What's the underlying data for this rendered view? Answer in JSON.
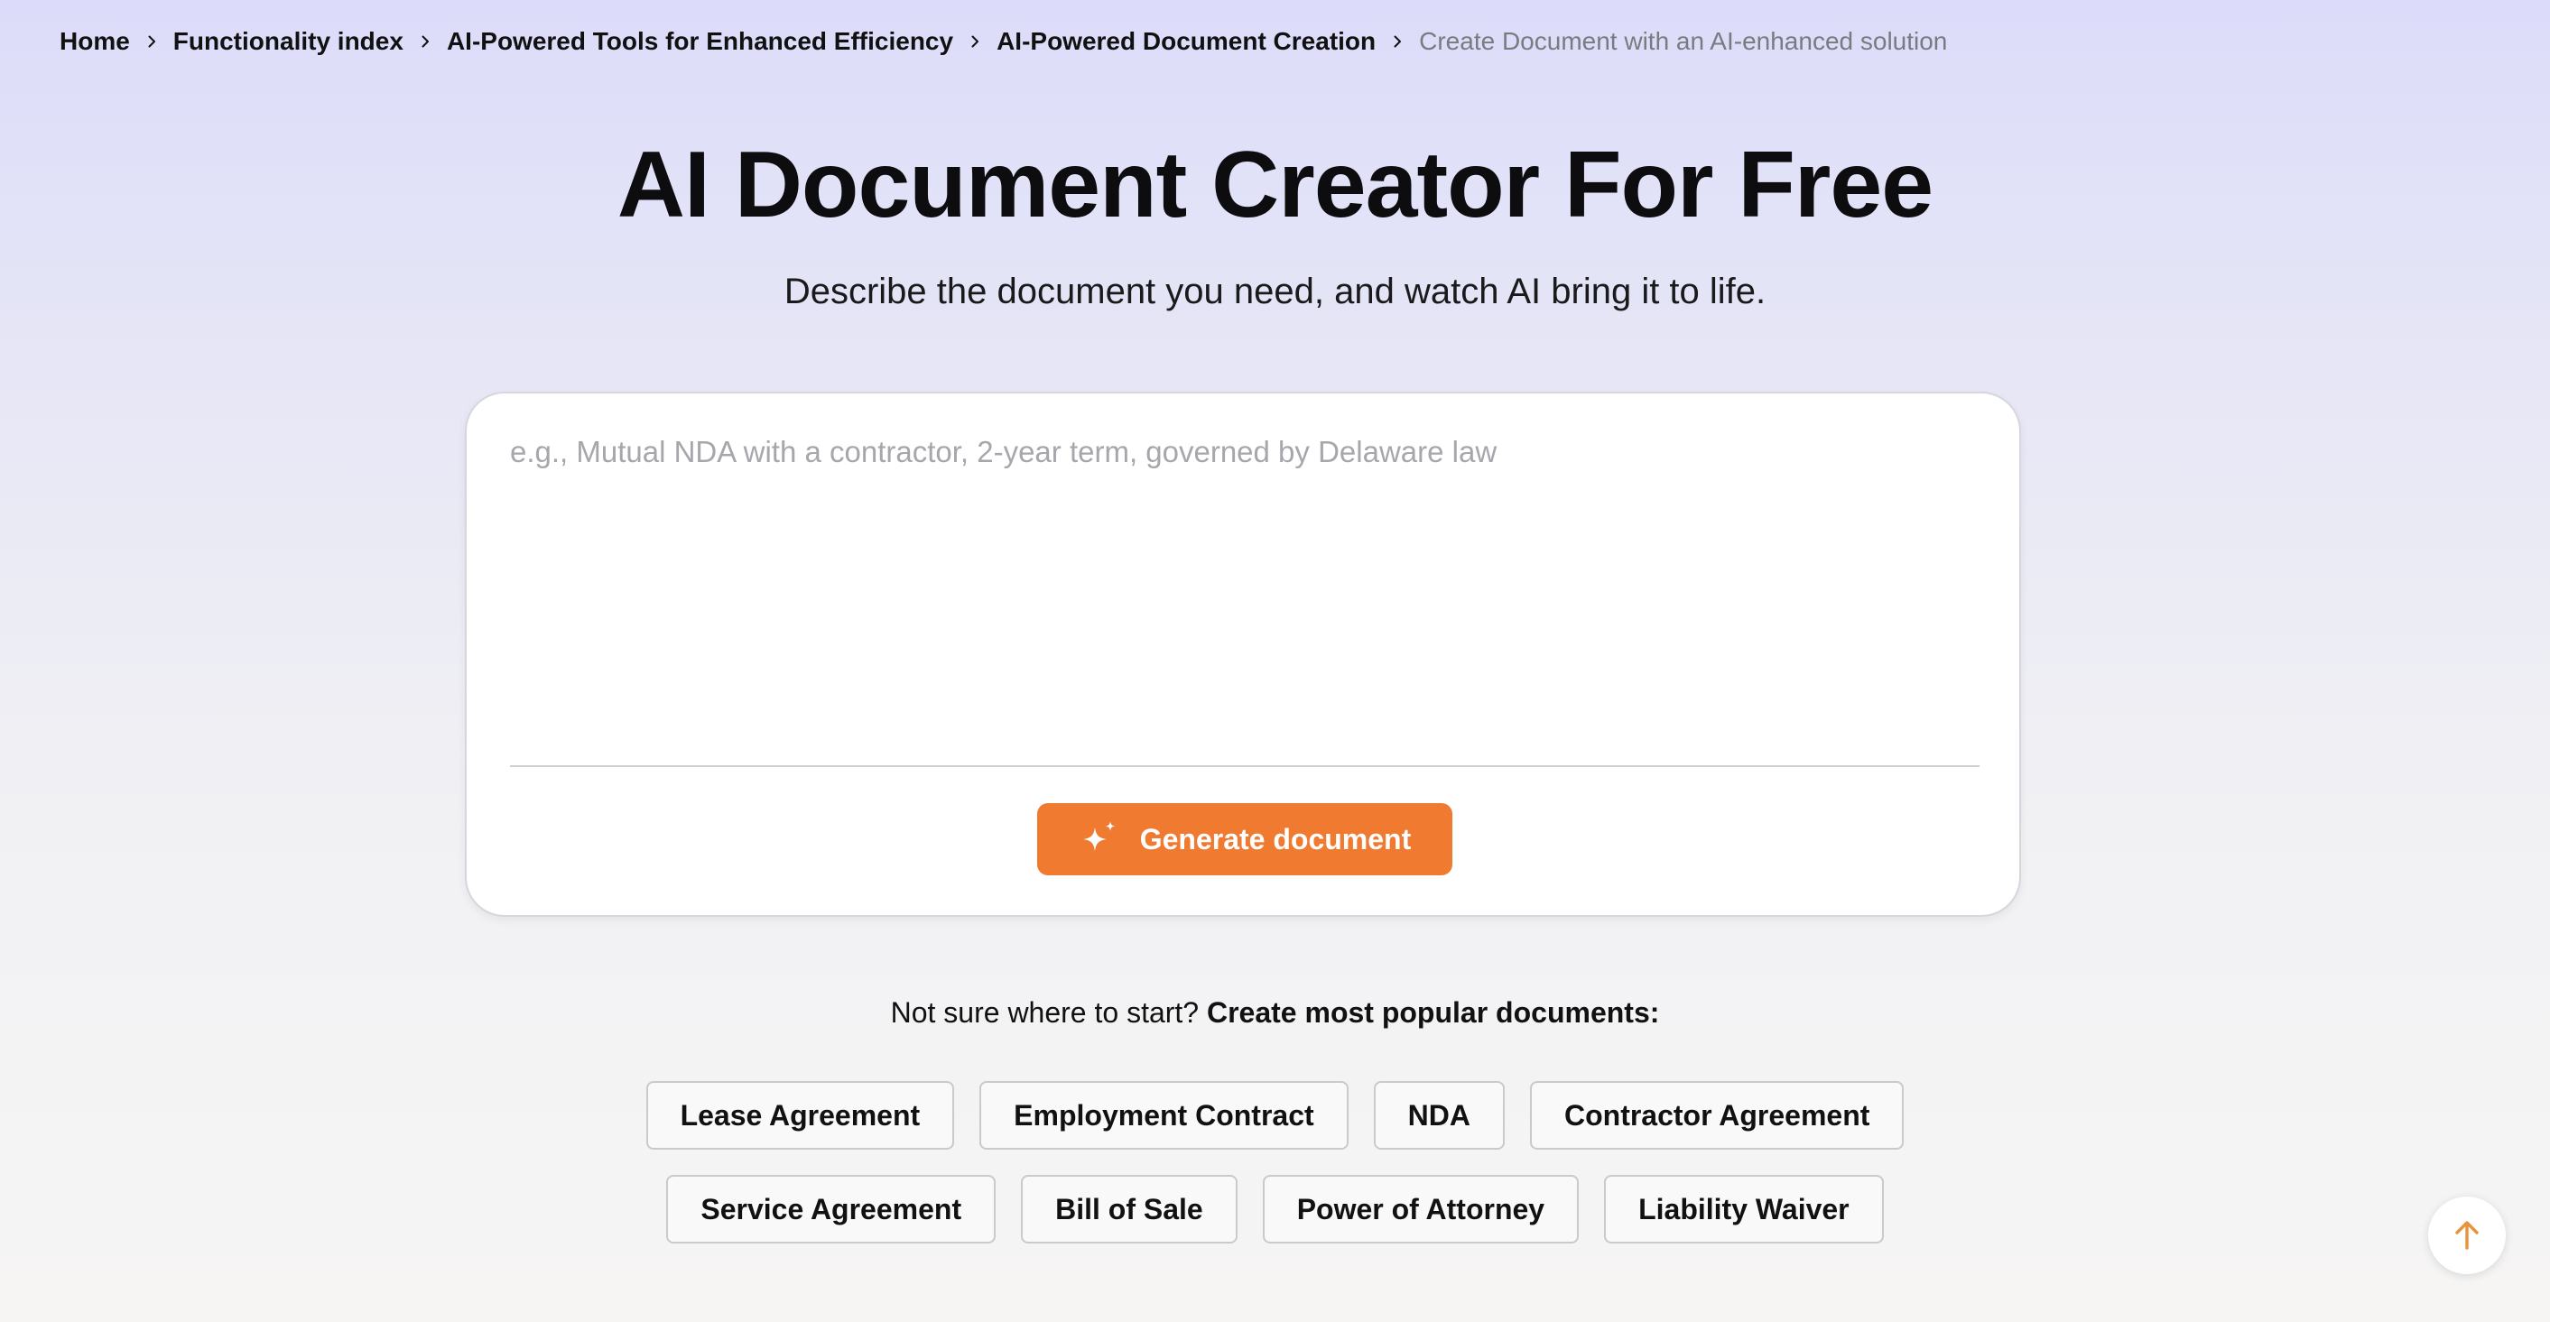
{
  "breadcrumb": {
    "items": [
      {
        "label": "Home"
      },
      {
        "label": "Functionality index"
      },
      {
        "label": "AI-Powered Tools for Enhanced Efficiency"
      },
      {
        "label": "AI-Powered Document Creation"
      },
      {
        "label": "Create Document with an AI-enhanced solution"
      }
    ],
    "separator_icon": "chevron-right-icon"
  },
  "hero": {
    "title": "AI Document Creator For Free",
    "subtitle": "Describe the document you need, and watch AI bring it to life."
  },
  "prompt": {
    "placeholder": "e.g., Mutual NDA with a contractor, 2-year term, governed by Delaware law",
    "value": "",
    "generate_label": "Generate document",
    "generate_icon": "sparkle-icon"
  },
  "popular": {
    "lead_text": "Not sure where to start?",
    "strong_text": "Create most popular documents:",
    "chips_row_1": [
      "Lease Agreement",
      "Employment Contract",
      "NDA",
      "Contractor Agreement"
    ],
    "chips_row_2": [
      "Service Agreement",
      "Bill of Sale",
      "Power of Attorney",
      "Liability Waiver"
    ]
  },
  "scroll_top": {
    "icon": "arrow-up-icon"
  },
  "colors": {
    "accent": "#f07a30",
    "scroll_arrow": "#e8923a",
    "bg_top": "#dcdcfa",
    "bg_bottom": "#f6f5f4"
  }
}
